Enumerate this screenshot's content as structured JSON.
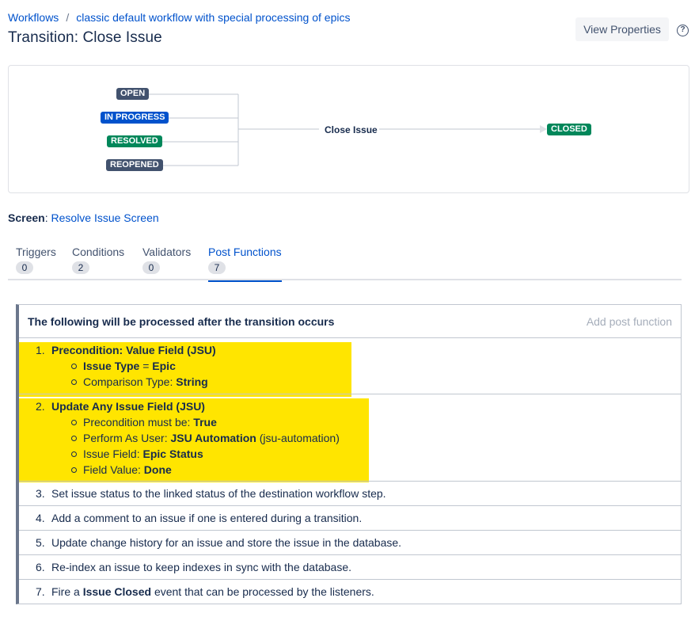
{
  "breadcrumb": {
    "root": "Workflows",
    "separator": "/",
    "workflow": "classic default workflow with special processing of epics"
  },
  "page": {
    "title": "Transition: Close Issue",
    "view_properties": "View Properties",
    "help_glyph": "?"
  },
  "diagram": {
    "sources": [
      {
        "label": "OPEN",
        "color": "#42526e"
      },
      {
        "label": "IN PROGRESS",
        "color": "#0052cc"
      },
      {
        "label": "RESOLVED",
        "color": "#00875a"
      },
      {
        "label": "REOPENED",
        "color": "#42526e"
      }
    ],
    "transition": "Close Issue",
    "target": {
      "label": "CLOSED",
      "color": "#00875a"
    }
  },
  "screen": {
    "label": "Screen",
    "value": "Resolve Issue Screen"
  },
  "tabs": [
    {
      "label": "Triggers",
      "count": "0"
    },
    {
      "label": "Conditions",
      "count": "2"
    },
    {
      "label": "Validators",
      "count": "0"
    },
    {
      "label": "Post Functions",
      "count": "7",
      "active": true
    }
  ],
  "post_functions": {
    "header": "The following will be processed after the transition occurs",
    "add_link": "Add post function",
    "items": [
      {
        "num": "1.",
        "title": "Precondition: Value Field (JSU)",
        "details": [
          {
            "label": "Issue Type",
            "sep": " = ",
            "value": "Epic"
          },
          {
            "label": "Comparison Type: ",
            "value": "String"
          }
        ]
      },
      {
        "num": "2.",
        "title": "Update Any Issue Field (JSU)",
        "details": [
          {
            "label": "Precondition must be: ",
            "value": "True"
          },
          {
            "label": "Perform As User: ",
            "value": "JSU Automation",
            "suffix": " (jsu-automation)"
          },
          {
            "label": "Issue Field: ",
            "value": "Epic Status"
          },
          {
            "label": "Field Value: ",
            "value": "Done"
          }
        ]
      },
      {
        "num": "3.",
        "text": "Set issue status to the linked status of the destination workflow step."
      },
      {
        "num": "4.",
        "text": "Add a comment to an issue if one is entered during a transition."
      },
      {
        "num": "5.",
        "text": "Update change history for an issue and store the issue in the database."
      },
      {
        "num": "6.",
        "text": "Re-index an issue to keep indexes in sync with the database."
      },
      {
        "num": "7.",
        "text_before": "Fire a ",
        "text_bold": "Issue Closed",
        "text_after": " event that can be processed by the listeners."
      }
    ]
  },
  "colors": {
    "highlight": "#ffe500",
    "link": "#0052cc",
    "text": "#172b4d"
  }
}
